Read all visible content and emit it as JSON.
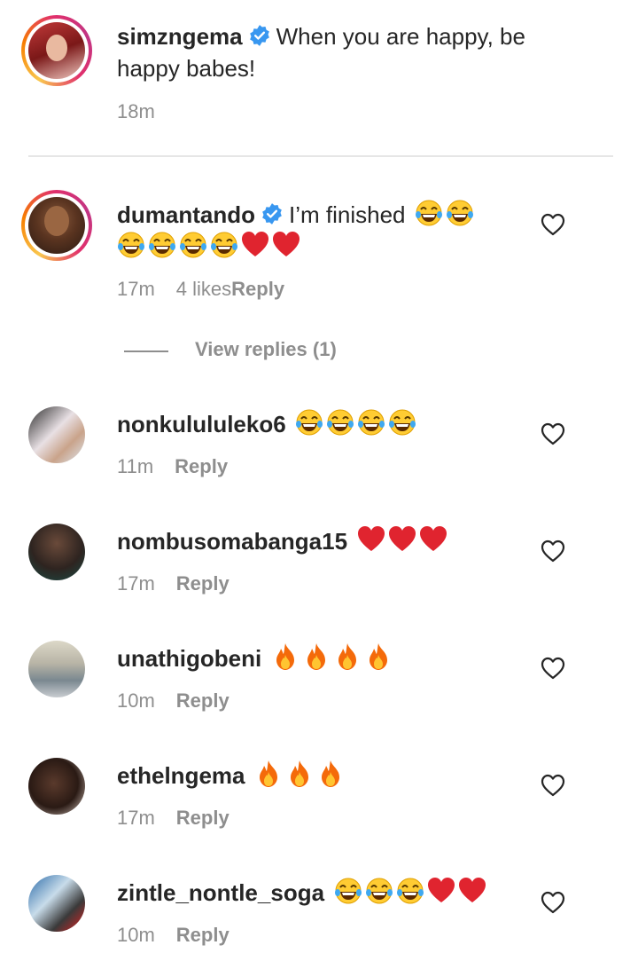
{
  "post": {
    "username": "simzngema",
    "caption_line1": "When you are happy, be",
    "caption_line2": "happy babes!",
    "time": "18m"
  },
  "comments": [
    {
      "username": "dumantando",
      "text": "I’m finished",
      "time": "17m",
      "likes": "4 likes",
      "reply": "Reply"
    },
    {
      "username": "nonkulululeko6",
      "time": "11m",
      "reply": "Reply"
    },
    {
      "username": "nombusomabanga15",
      "time": "17m",
      "reply": "Reply"
    },
    {
      "username": "unathigobeni",
      "time": "10m",
      "reply": "Reply"
    },
    {
      "username": "ethelngema",
      "time": "17m",
      "reply": "Reply"
    },
    {
      "username": "zintle_nontle_soga",
      "time": "10m",
      "reply": "Reply"
    }
  ],
  "view_replies": "View replies (1)",
  "icons": {
    "verified": "verified-badge-icon",
    "like": "heart-outline-icon",
    "laugh": "face-with-tears-of-joy-emoji",
    "heart": "red-heart-emoji",
    "fire": "fire-emoji"
  },
  "colors": {
    "verified": "#3897f0",
    "muted": "#8e8e8e",
    "text": "#262626",
    "red_heart": "#e0242f"
  }
}
